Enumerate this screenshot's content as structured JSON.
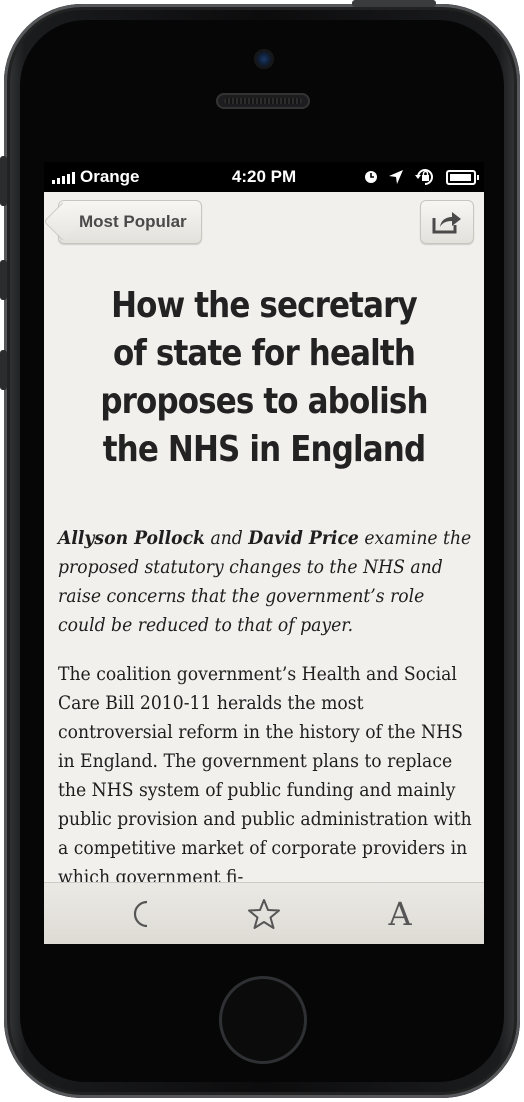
{
  "status_bar": {
    "carrier": "Orange",
    "time": "4:20 PM",
    "icons": [
      "signal-bars-icon",
      "clock-icon",
      "location-arrow-icon",
      "rotation-lock-icon",
      "battery-icon"
    ]
  },
  "nav": {
    "back_label": "Most Popular",
    "share_icon": "share-icon"
  },
  "article": {
    "title": "How  the secretary of state for health proposes to abolish the NHS in England",
    "standfirst": {
      "author1": "Allyson Pollock",
      "and": "and",
      "author2": "David Price",
      "text": "examine the proposed statutory changes to the NHS and raise concerns that the government’s role could be reduced to that of payer."
    },
    "body": "The coalition government’s Health and Social Care Bill 2010-11 heralds the most controversial reform in the history of the NHS in England. The government plans to replace the NHS system of public funding and mainly public provision and public administration with a competitive market of corporate providers in which government fi-"
  },
  "toolbar": {
    "night_icon": "moon-icon",
    "favorite_icon": "star-icon",
    "font_icon": "font-size-icon",
    "font_glyph": "A"
  },
  "colors": {
    "screen_bg": "#f1f0ed",
    "text": "#222222",
    "toolbar_bg": "#e4e2dd"
  }
}
